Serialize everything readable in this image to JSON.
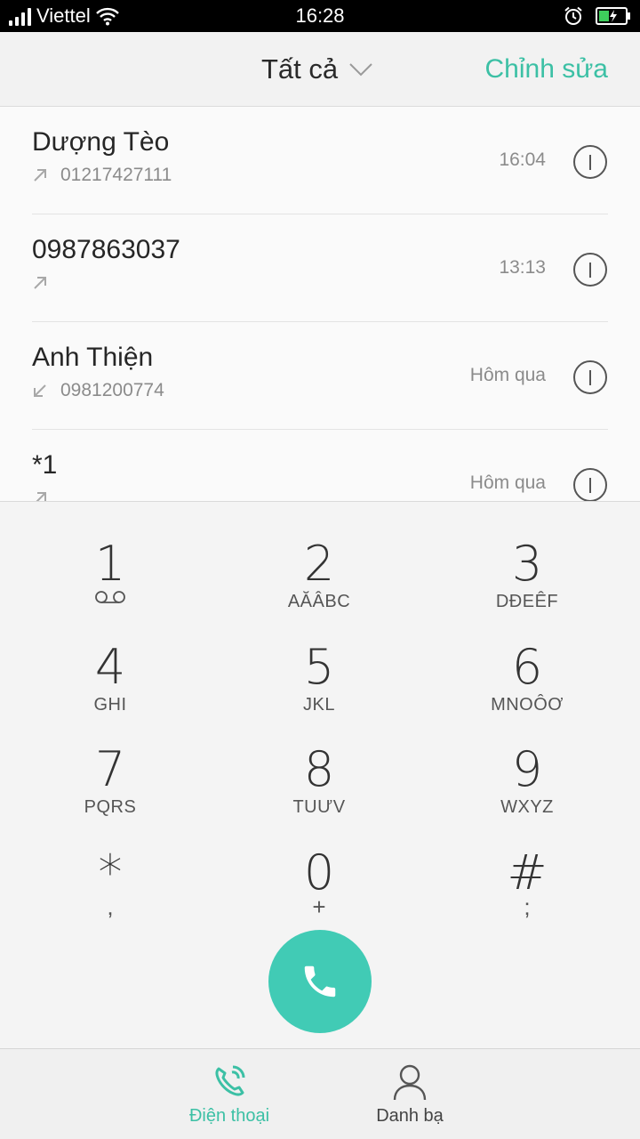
{
  "status_bar": {
    "carrier": "Viettel",
    "time": "16:28"
  },
  "header": {
    "filter_label": "Tất cả",
    "edit_label": "Chỉnh sửa"
  },
  "call_log": [
    {
      "name": "Dượng Tèo",
      "number": "01217427111",
      "time": "16:04",
      "direction": "outgoing"
    },
    {
      "name": "0987863037",
      "number": "",
      "time": "13:13",
      "direction": "outgoing"
    },
    {
      "name": "Anh Thiện",
      "number": "0981200774",
      "time": "Hôm qua",
      "direction": "incoming"
    },
    {
      "name": "*1",
      "number": "",
      "time": "Hôm qua",
      "direction": "outgoing"
    }
  ],
  "dialpad": {
    "keys": [
      {
        "digit": "1",
        "letters": "",
        "sub": ""
      },
      {
        "digit": "2",
        "letters": "AĂÂBC",
        "sub": ""
      },
      {
        "digit": "3",
        "letters": "DĐEÊF",
        "sub": ""
      },
      {
        "digit": "4",
        "letters": "GHI",
        "sub": ""
      },
      {
        "digit": "5",
        "letters": "JKL",
        "sub": ""
      },
      {
        "digit": "6",
        "letters": "MNOÔƠ",
        "sub": ""
      },
      {
        "digit": "7",
        "letters": "PQRS",
        "sub": ""
      },
      {
        "digit": "8",
        "letters": "TUƯV",
        "sub": ""
      },
      {
        "digit": "9",
        "letters": "WXYZ",
        "sub": ""
      },
      {
        "digit": "*",
        "letters": "",
        "sub": ","
      },
      {
        "digit": "0",
        "letters": "",
        "sub": "+"
      },
      {
        "digit": "#",
        "letters": "",
        "sub": ";"
      }
    ]
  },
  "bottom_nav": {
    "tabs": [
      {
        "label": "Điện thoại",
        "active": true
      },
      {
        "label": "Danh bạ",
        "active": false
      }
    ]
  },
  "colors": {
    "accent": "#3cc0a5",
    "call_button": "#41cbb5",
    "text_secondary": "#8b8b8b"
  }
}
